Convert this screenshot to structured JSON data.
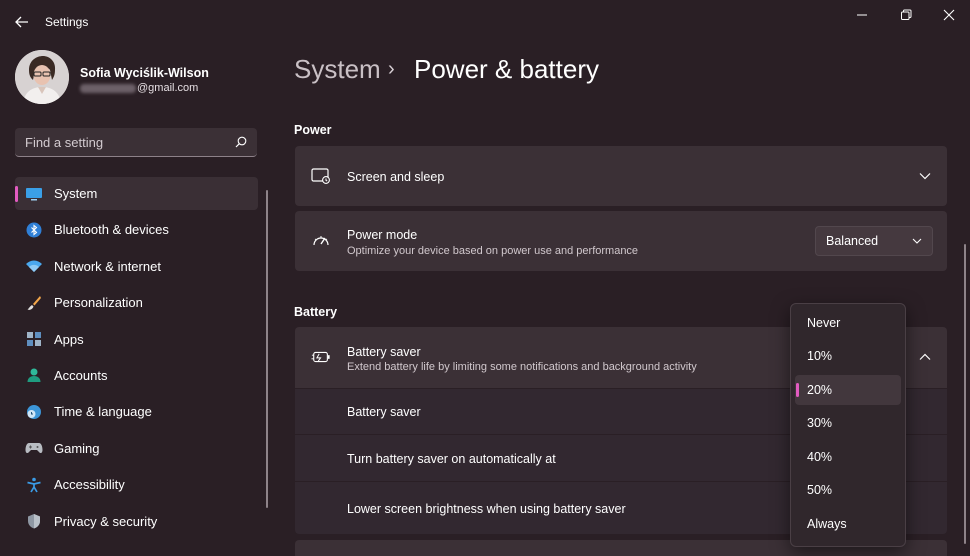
{
  "window": {
    "title": "Settings",
    "controls": [
      "minimize",
      "restore",
      "close"
    ]
  },
  "profile": {
    "name": "Sofia Wyciślik-Wilson",
    "email_domain": "@gmail.com"
  },
  "search": {
    "placeholder": "Find a setting"
  },
  "sidebar": {
    "items": [
      {
        "label": "System",
        "icon": "monitor-icon",
        "active": true
      },
      {
        "label": "Bluetooth & devices",
        "icon": "bluetooth-icon"
      },
      {
        "label": "Network & internet",
        "icon": "wifi-icon"
      },
      {
        "label": "Personalization",
        "icon": "brush-icon"
      },
      {
        "label": "Apps",
        "icon": "apps-icon"
      },
      {
        "label": "Accounts",
        "icon": "person-icon"
      },
      {
        "label": "Time & language",
        "icon": "clock-globe-icon"
      },
      {
        "label": "Gaming",
        "icon": "gamepad-icon"
      },
      {
        "label": "Accessibility",
        "icon": "accessibility-icon"
      },
      {
        "label": "Privacy & security",
        "icon": "shield-icon"
      }
    ]
  },
  "breadcrumb": {
    "parent": "System",
    "separator": "›",
    "current": "Power & battery"
  },
  "power": {
    "section_title": "Power",
    "screen_sleep": {
      "title": "Screen and sleep"
    },
    "power_mode": {
      "title": "Power mode",
      "subtitle": "Optimize your device based on power use and performance",
      "value": "Balanced"
    }
  },
  "battery": {
    "section_title": "Battery",
    "saver": {
      "title": "Battery saver",
      "subtitle": "Extend battery life by limiting some notifications and background activity"
    },
    "rows": [
      {
        "label": "Battery saver"
      },
      {
        "label": "Turn battery saver on automatically at"
      },
      {
        "label": "Lower screen brightness when using battery saver"
      }
    ]
  },
  "threshold_menu": {
    "options": [
      "Never",
      "10%",
      "20%",
      "30%",
      "40%",
      "50%",
      "Always"
    ],
    "selected": "20%"
  },
  "colors": {
    "accent": "#e25bc0",
    "background": "#2a1f25",
    "card": "#3b3036"
  }
}
